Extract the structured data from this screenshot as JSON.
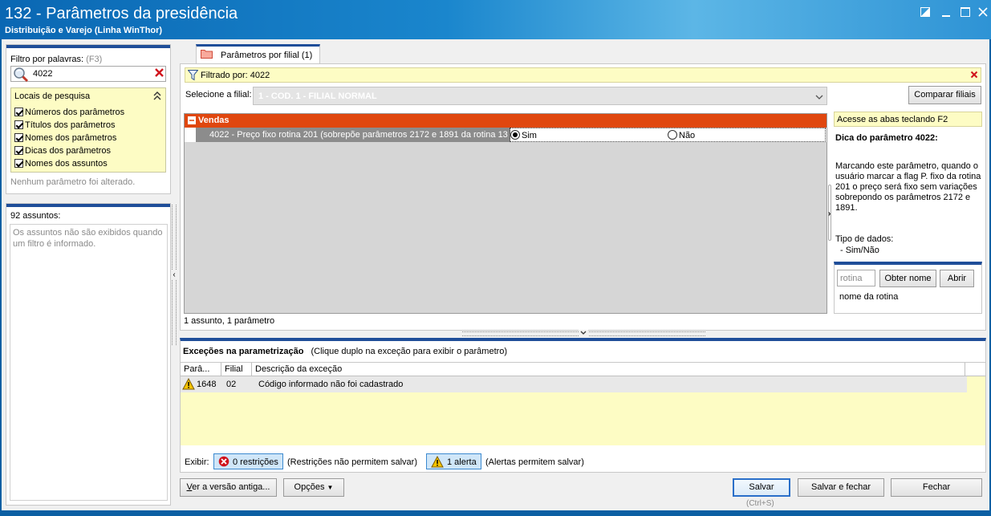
{
  "window": {
    "title": "132 - Parâmetros da presidência",
    "subtitle": "Distribuição e Varejo (Linha WinThor)"
  },
  "filter": {
    "label": "Filtro por palavras:",
    "shortcut": "(F3)",
    "value": "4022",
    "search_locations_title": "Locais de pesquisa",
    "locations": [
      "Números dos parâmetros",
      "Títulos dos parâmetros",
      "Nomes dos parâmetros",
      "Dicas dos parâmetros",
      "Nomes dos assuntos"
    ],
    "status": "Nenhum parâmetro foi alterado."
  },
  "subjects": {
    "count_label": "92 assuntos:",
    "note": "Os assuntos não são exibidos quando um filtro é informado."
  },
  "tab": {
    "label": "Parâmetros por filial",
    "count": "(1)"
  },
  "filtered": {
    "text": "Filtrado por: 4022"
  },
  "branch": {
    "label": "Selecione a filial:",
    "value": "1 - COD. 1 - FILIAL NORMAL",
    "compare_button": "Comparar filiais"
  },
  "params": {
    "group": "Vendas",
    "row_label": "4022 - Preço fixo rotina 201 (sobrepõe parâmetros 2172 e 1891 da rotina 13",
    "option_yes": "Sim",
    "option_no": "Não",
    "summary": "1 assunto, 1 parâmetro"
  },
  "hint": {
    "tabs_hint": "Acesse as abas teclando F2",
    "title": "Dica do parâmetro 4022:",
    "body": "Marcando este parâmetro, quando o usuário marcar a flag P. fixo da rotina 201 o preço será fixo sem variações sobrepondo os parâmetros 2172 e 1891.",
    "data_type_label": "Tipo de dados:",
    "data_type_value": "- Sim/Não",
    "routine_placeholder": "rotina",
    "get_name_button": "Obter nome",
    "open_button": "Abrir",
    "routine_name": "nome da rotina"
  },
  "exceptions": {
    "title": "Exceções na parametrização",
    "subtitle": "(Clique duplo na exceção para exibir o parâmetro)",
    "columns": [
      "Parâ...",
      "Filial",
      "Descrição da exceção"
    ],
    "rows": [
      {
        "param": "1648",
        "branch": "02",
        "description": "Código informado não foi cadastrado"
      }
    ],
    "show_label": "Exibir:",
    "restrictions_button": "0 restrições",
    "restrictions_note": "(Restrições não permitem salvar)",
    "alerts_button": "1 alerta",
    "alerts_note": "(Alertas permitem salvar)"
  },
  "footer": {
    "old_version_button": "Ver a versão antiga...",
    "options_button": "Opções",
    "save_button": "Salvar",
    "save_shortcut": "(Ctrl+S)",
    "save_close_button": "Salvar e fechar",
    "close_button": "Fechar"
  },
  "colors": {
    "title_bar": "#0a67b3",
    "group_header": "#e0470f",
    "selected_row": "#8c8c8c",
    "yellow_bg": "#fdfcc4",
    "accent_bar": "#1f4e99"
  }
}
